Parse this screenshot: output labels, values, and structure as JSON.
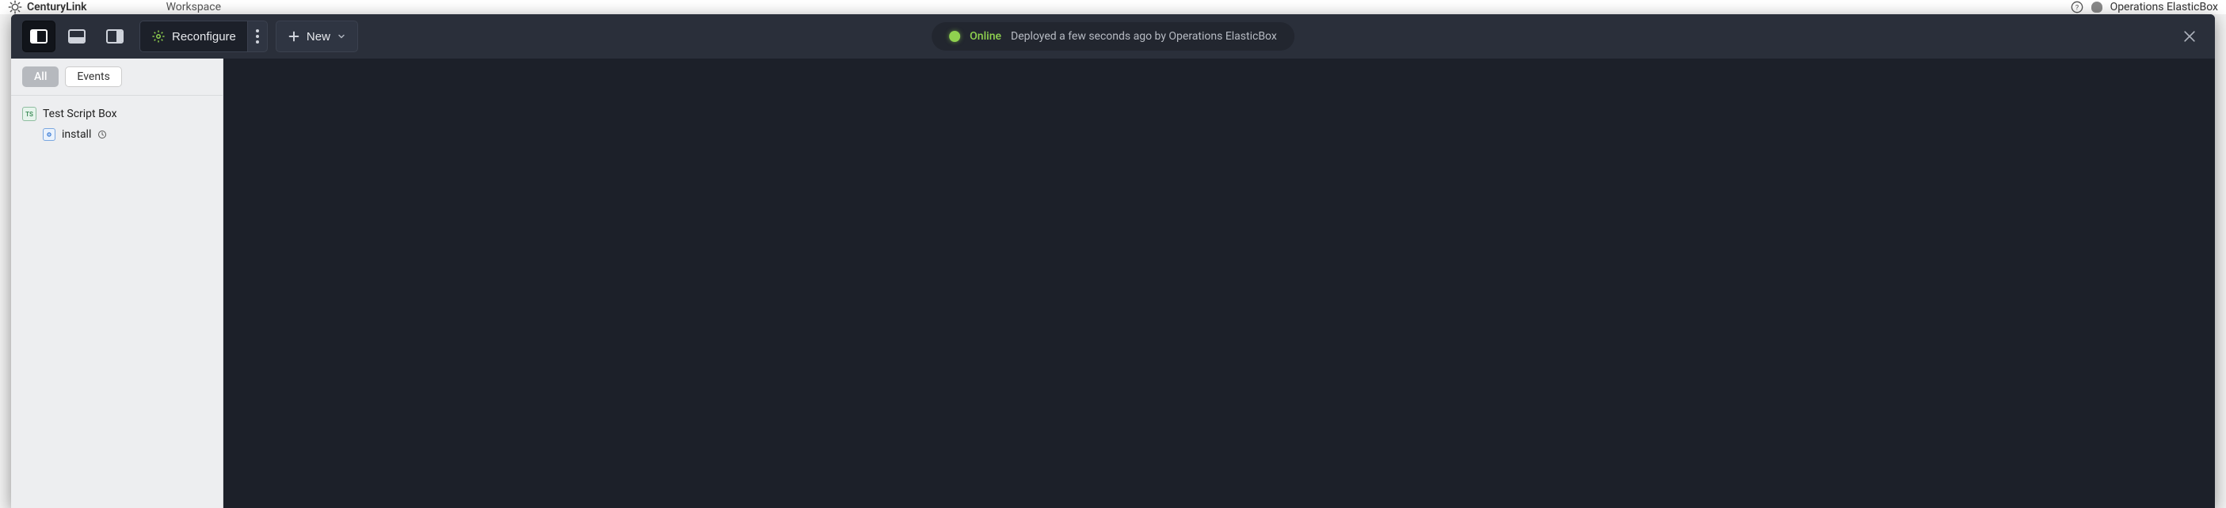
{
  "background": {
    "brand": "CenturyLink",
    "workspace_breadcrumb": "Workspace",
    "user_label": "Operations ElasticBox"
  },
  "toolbar": {
    "layout_buttons": {
      "left_panel": "layout-left-panel",
      "bottom_panel": "layout-bottom-panel",
      "right_panel": "layout-right-panel"
    },
    "reconfigure_label": "Reconfigure",
    "new_label": "New"
  },
  "status": {
    "state": "Online",
    "detail": "Deployed a few seconds ago by Operations ElasticBox"
  },
  "sidebar": {
    "filters": {
      "all": "All",
      "events": "Events"
    },
    "box": {
      "badge": "TS",
      "title": "Test Script Box",
      "children": [
        {
          "label": "install"
        }
      ]
    }
  }
}
